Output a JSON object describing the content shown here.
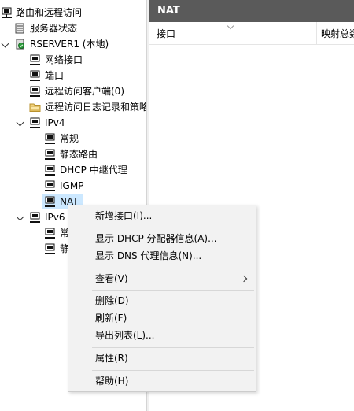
{
  "tree": {
    "root_label": "路由和远程访问",
    "server_status": "服务器状态",
    "server_label": "RSERVER1 (本地)",
    "network_interfaces": "网络接口",
    "ports": "端口",
    "remote_clients": "远程访问客户端(0)",
    "remote_logging": "远程访问日志记录和策略",
    "ipv4": "IPv4",
    "ipv4_general": "常规",
    "ipv4_static_routes": "静态路由",
    "ipv4_dhcp_relay": "DHCP 中继代理",
    "ipv4_igmp": "IGMP",
    "ipv4_nat": "NAT",
    "ipv6": "IPv6",
    "ipv6_general_partial": "常",
    "ipv6_static_partial": "静"
  },
  "right_pane": {
    "title": "NAT",
    "columns": [
      "接口",
      "映射总数"
    ]
  },
  "context_menu": {
    "new_interface": "新增接口(I)...",
    "show_dhcp": "显示 DHCP 分配器信息(A)...",
    "show_dns": "显示 DNS 代理信息(N)...",
    "view": "查看(V)",
    "delete": "删除(D)",
    "refresh": "刷新(F)",
    "export_list": "导出列表(L)...",
    "properties": "属性(R)",
    "help": "帮助(H)"
  },
  "colors": {
    "title_bar": "#5a5a5a",
    "menu_bg": "#f2f2f2",
    "nat_highlight": "#cce8ff"
  }
}
